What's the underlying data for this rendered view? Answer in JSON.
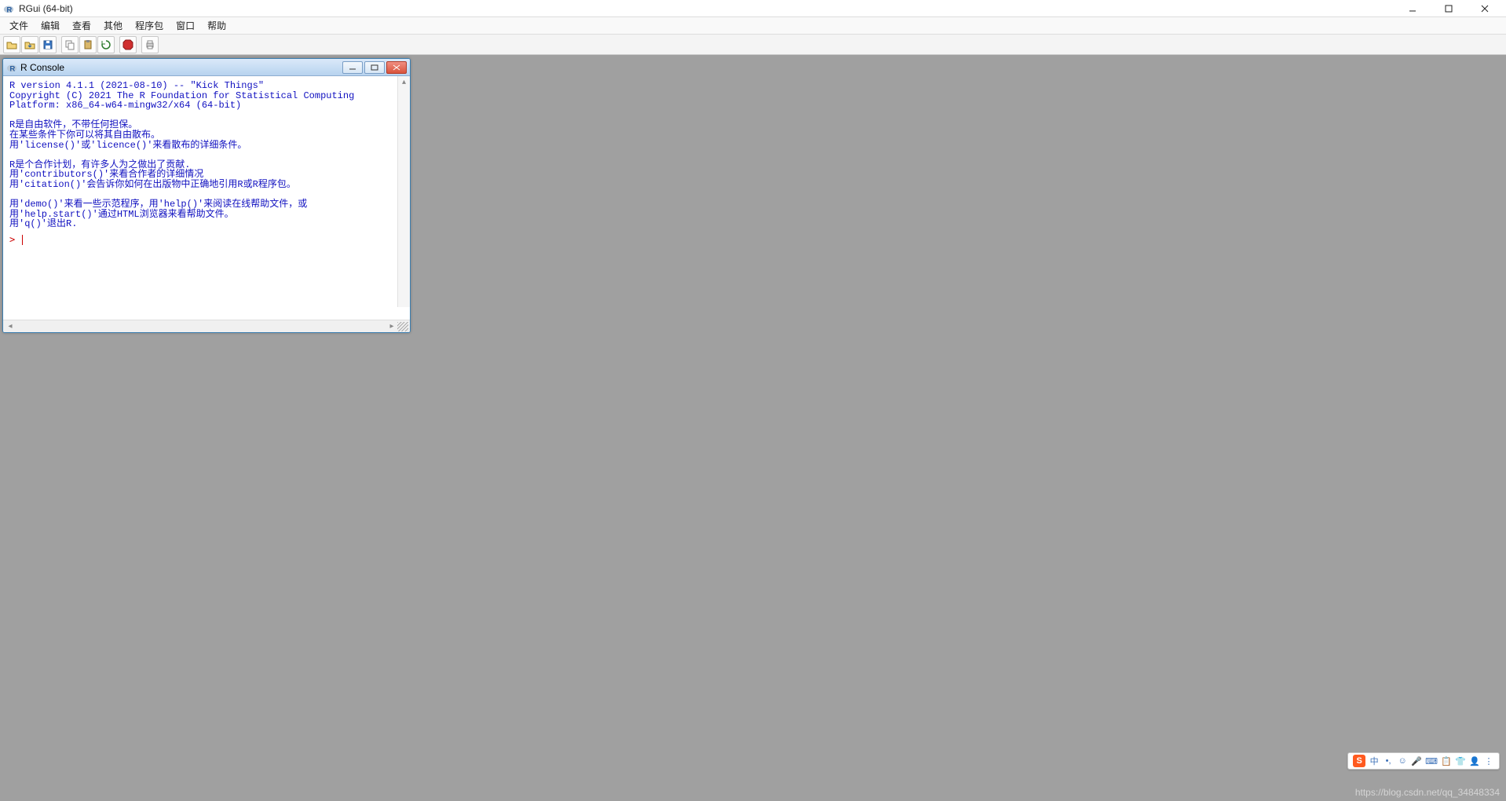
{
  "window": {
    "title": "RGui (64-bit)"
  },
  "menu": {
    "items": [
      "文件",
      "编辑",
      "查看",
      "其他",
      "程序包",
      "窗口",
      "帮助"
    ]
  },
  "toolbar": {
    "icons": [
      "open-icon",
      "load-workspace-icon",
      "save-icon",
      "copy-icon",
      "paste-icon",
      "refresh-icon",
      "stop-icon",
      "print-icon"
    ]
  },
  "console": {
    "title": "R Console",
    "text": "R version 4.1.1 (2021-08-10) -- \"Kick Things\"\nCopyright (C) 2021 The R Foundation for Statistical Computing\nPlatform: x86_64-w64-mingw32/x64 (64-bit)\n\nR是自由软件，不带任何担保。\n在某些条件下你可以将其自由散布。\n用'license()'或'licence()'来看散布的详细条件。\n\nR是个合作计划，有许多人为之做出了贡献.\n用'contributors()'来看合作者的详细情况\n用'citation()'会告诉你如何在出版物中正确地引用R或R程序包。\n\n用'demo()'来看一些示范程序，用'help()'来阅读在线帮助文件，或\n用'help.start()'通过HTML浏览器来看帮助文件。\n用'q()'退出R.",
    "prompt": ">"
  },
  "ime": {
    "logo": "S",
    "items": [
      "中",
      "•,",
      "☺",
      "🎤",
      "⌨",
      "📋",
      "👕",
      "👤",
      "⋮"
    ]
  },
  "watermark": "https://blog.csdn.net/qq_34848334"
}
